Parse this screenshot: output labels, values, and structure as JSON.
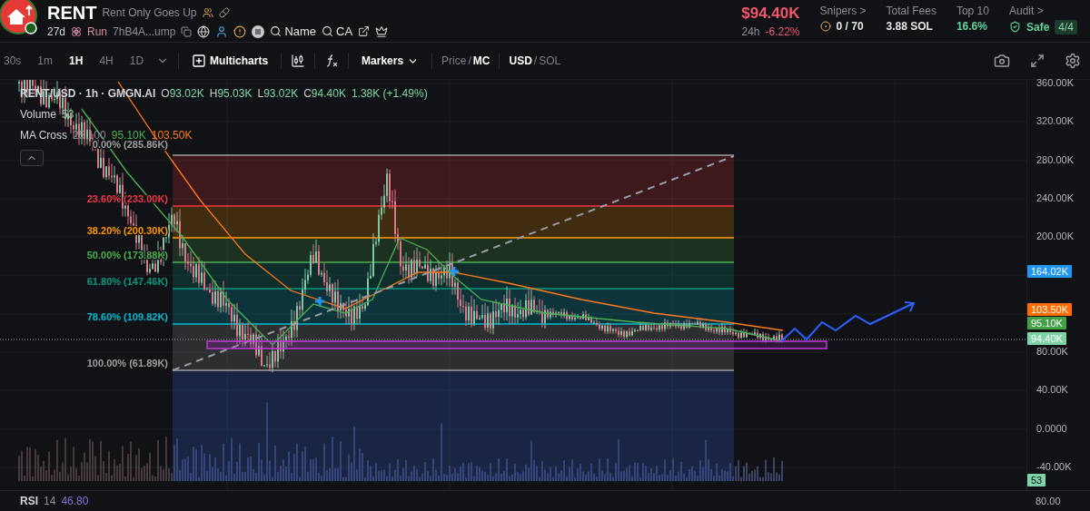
{
  "header": {
    "symbol": "RENT",
    "tagline": "Rent Only Goes Up",
    "age": "27d",
    "launchpad": "Run",
    "address": "7hB4A...ump",
    "search_links": [
      {
        "label": "Name"
      },
      {
        "label": "CA"
      }
    ],
    "price": "$94.40K",
    "change_period": "24h",
    "change": "-6.22%",
    "stats": [
      {
        "kind": "snipers",
        "label": "Snipers >",
        "value": "0 / 70"
      },
      {
        "kind": "plain",
        "label": "Total Fees",
        "value": "3.88 SOL"
      },
      {
        "kind": "positive",
        "label": "Top 10",
        "value": "16.6%"
      },
      {
        "kind": "audit",
        "label": "Audit >",
        "value": "Safe",
        "badge": "4/4"
      }
    ]
  },
  "toolbar": {
    "intervals": [
      {
        "label": "30s",
        "selected": false
      },
      {
        "label": "1m",
        "selected": false
      },
      {
        "label": "1H",
        "selected": true
      },
      {
        "label": "4H",
        "selected": false
      },
      {
        "label": "1D",
        "selected": false
      }
    ],
    "multicharts": "Multicharts",
    "markers": "Markers",
    "value_mode_separator": "/",
    "currency_separator": "/",
    "value_mode": [
      {
        "label": "Price",
        "selected": false
      },
      {
        "label": "MC",
        "selected": true
      }
    ],
    "currency": [
      {
        "label": "USD",
        "selected": true
      },
      {
        "label": "SOL",
        "selected": false
      }
    ]
  },
  "chart": {
    "legend": {
      "pair": "RENT/USD · 1h · GMGN.AI",
      "ohlc": [
        {
          "label": "O",
          "value": "93.02K"
        },
        {
          "label": "H",
          "value": "95.03K"
        },
        {
          "label": "L",
          "value": "93.02K"
        },
        {
          "label": "C",
          "value": "94.40K"
        }
      ],
      "change": "1.38K (+1.49%)",
      "volume_label": "Volume",
      "volume_value": "53",
      "ma_label": "MA Cross",
      "ma_params": "25 100",
      "ma_values": [
        {
          "value": "95.10K",
          "color": "#4caf50"
        },
        {
          "value": "103.50K",
          "color": "#ff7a1a"
        }
      ]
    },
    "fib_levels": [
      {
        "label": "0.00% (285.86K)",
        "color": "#9e9e9e"
      },
      {
        "label": "23.60% (233.00K)",
        "color": "#f23645"
      },
      {
        "label": "38.20% (200.30K)",
        "color": "#ff9800"
      },
      {
        "label": "50.00% (173.88K)",
        "color": "#4caf50"
      },
      {
        "label": "61.80% (147.46K)",
        "color": "#089981"
      },
      {
        "label": "78.60% (109.82K)",
        "color": "#00bcd4"
      },
      {
        "label": "100.00% (61.89K)",
        "color": "#9e9e9e"
      }
    ],
    "price_axis": [
      "360.00K",
      "320.00K",
      "280.00K",
      "240.00K",
      "200.00K",
      "80.00K",
      "40.00K",
      "0.0000",
      "-40.00K"
    ],
    "price_tags": [
      {
        "value": "164.02K",
        "color": "#2196f3"
      },
      {
        "value": "103.50K",
        "color": "#ff6d00"
      },
      {
        "value": "95.10K",
        "color": "#43a047"
      },
      {
        "value": "94.40K",
        "color": "#7fd3a8"
      }
    ],
    "volume_tag": "53"
  },
  "rsi": {
    "label": "RSI",
    "period": "14",
    "value": "46.80",
    "axis_label": "80.00"
  }
}
